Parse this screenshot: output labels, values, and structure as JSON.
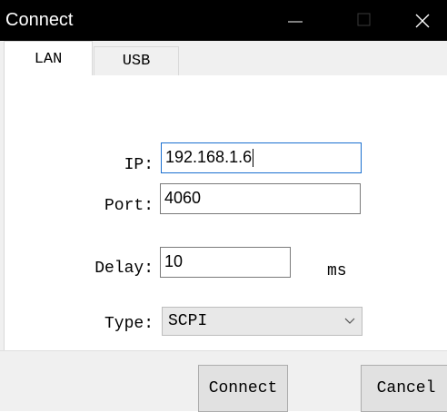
{
  "window": {
    "title": "Connect",
    "controls": [
      "minimize-icon",
      "maximize-icon",
      "close-icon"
    ]
  },
  "tabs": [
    {
      "label": "LAN",
      "selected": true
    },
    {
      "label": "USB",
      "selected": false
    }
  ],
  "form": {
    "ip": {
      "label": "IP:",
      "value": "192.168.1.6"
    },
    "port": {
      "label": "Port:",
      "value": "4060"
    },
    "delay": {
      "label": "Delay:",
      "value": "10",
      "unit": "ms"
    },
    "type": {
      "label": "Type:",
      "value": "SCPI"
    }
  },
  "buttons": {
    "connect": "Connect",
    "cancel": "Cancel"
  },
  "colors": {
    "titlebar": "#000000",
    "focus_border": "#1a6fd0",
    "dialog_bg": "#f0f0f0"
  }
}
